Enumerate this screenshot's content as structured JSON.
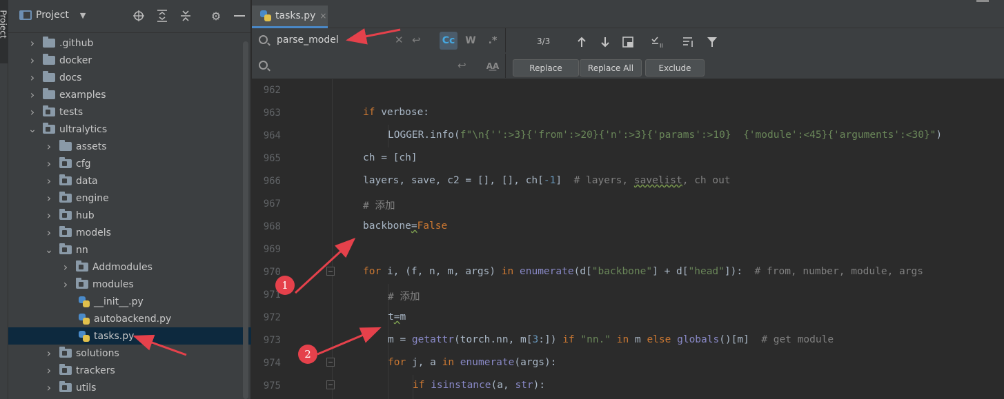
{
  "tool_stripe": {
    "project_label": "Project"
  },
  "project_panel": {
    "title": "Project",
    "tree": [
      {
        "label": ".github",
        "type": "folder",
        "depth": 1,
        "expanded": false
      },
      {
        "label": "docker",
        "type": "folder",
        "depth": 1,
        "expanded": false
      },
      {
        "label": "docs",
        "type": "folder",
        "depth": 1,
        "expanded": false
      },
      {
        "label": "examples",
        "type": "folder",
        "depth": 1,
        "expanded": false
      },
      {
        "label": "tests",
        "type": "package",
        "depth": 1,
        "expanded": false
      },
      {
        "label": "ultralytics",
        "type": "package",
        "depth": 1,
        "expanded": true
      },
      {
        "label": "assets",
        "type": "folder",
        "depth": 2,
        "expanded": false
      },
      {
        "label": "cfg",
        "type": "package",
        "depth": 2,
        "expanded": false
      },
      {
        "label": "data",
        "type": "package",
        "depth": 2,
        "expanded": false
      },
      {
        "label": "engine",
        "type": "package",
        "depth": 2,
        "expanded": false
      },
      {
        "label": "hub",
        "type": "package",
        "depth": 2,
        "expanded": false
      },
      {
        "label": "models",
        "type": "package",
        "depth": 2,
        "expanded": false
      },
      {
        "label": "nn",
        "type": "package",
        "depth": 2,
        "expanded": true
      },
      {
        "label": "Addmodules",
        "type": "package",
        "depth": 3,
        "expanded": false
      },
      {
        "label": "modules",
        "type": "package",
        "depth": 3,
        "expanded": false
      },
      {
        "label": "__init__.py",
        "type": "file",
        "depth": 3
      },
      {
        "label": "autobackend.py",
        "type": "file",
        "depth": 3
      },
      {
        "label": "tasks.py",
        "type": "file",
        "depth": 3,
        "selected": true
      },
      {
        "label": "solutions",
        "type": "package",
        "depth": 2,
        "expanded": false
      },
      {
        "label": "trackers",
        "type": "package",
        "depth": 2,
        "expanded": false
      },
      {
        "label": "utils",
        "type": "package",
        "depth": 2,
        "expanded": false
      }
    ]
  },
  "editor": {
    "tab": {
      "label": "tasks.py",
      "close": "×"
    },
    "find": {
      "search_value": "parse_model",
      "replace_value": "",
      "match_count": "3/3",
      "opt_case": "Cc",
      "opt_words": "W",
      "opt_regex": ".*",
      "opt_preserve": "A͟A",
      "btn_replace": "Replace",
      "btn_replace_all": "Replace All",
      "btn_exclude": "Exclude"
    },
    "lines": [
      {
        "num": "962"
      },
      {
        "num": "963"
      },
      {
        "num": "964"
      },
      {
        "num": "965"
      },
      {
        "num": "966"
      },
      {
        "num": "967"
      },
      {
        "num": "968"
      },
      {
        "num": "969"
      },
      {
        "num": "970"
      },
      {
        "num": "971"
      },
      {
        "num": "972"
      },
      {
        "num": "973"
      },
      {
        "num": "974"
      },
      {
        "num": "975"
      }
    ],
    "code": {
      "l963_kw": "if",
      "l963_rest": " verbose:",
      "l964_a": "LOGGER.info(",
      "l964_b": "f\"\\n{'':>3}{'from':>20}{'n':>3}{'params':>10}  {'module':<45}{'arguments':<30}\"",
      "l964_c": ")",
      "l965": "ch = [ch]",
      "l966_a": "layers, save, c2 = [], [], ch[",
      "l966_num": "-1",
      "l966_b": "]  ",
      "l966_cm_a": "# layers, ",
      "l966_cm_wav": "savelist",
      "l966_cm_b": ", ch out",
      "l967": "# 添加",
      "l968_a": "backbone",
      "l968_eq": "=",
      "l968_kw": "False",
      "l970_kw1": "for",
      "l970_a": " i, (f, n, m, args) ",
      "l970_kw2": "in",
      "l970_sp": " ",
      "l970_bi": "enumerate",
      "l970_b": "(d[",
      "l970_st1": "\"backbone\"",
      "l970_c": "] + d[",
      "l970_st2": "\"head\"",
      "l970_d": "]):  ",
      "l970_cm": "# from, number, module, args",
      "l971": "# 添加",
      "l972_a": "t",
      "l972_eq": "=",
      "l972_b": "m",
      "l973_a": "m = ",
      "l973_bi1": "getattr",
      "l973_b": "(torch.nn, m[",
      "l973_num": "3",
      "l973_c": ":]) ",
      "l973_kw1": "if",
      "l973_sp": " ",
      "l973_st": "\"nn.\"",
      "l973_sp2": " ",
      "l973_kw2": "in",
      "l973_d": " m ",
      "l973_kw3": "else",
      "l973_sp3": " ",
      "l973_bi2": "globals",
      "l973_e": "()[m]  ",
      "l973_cm": "# get module",
      "l974_kw1": "for",
      "l974_a": " j, a ",
      "l974_kw2": "in",
      "l974_sp": " ",
      "l974_bi": "enumerate",
      "l974_b": "(args):",
      "l975_kw": "if",
      "l975_sp": " ",
      "l975_bi": "isinstance",
      "l975_a": "(a, ",
      "l975_bi2": "str",
      "l975_b": "):"
    }
  },
  "annotations": {
    "badge1": "1",
    "badge2": "2",
    "arrow_color": "#e5414b"
  },
  "colors": {
    "keyword": "#cc7832",
    "string": "#6a8759",
    "comment": "#808080",
    "number": "#6897bb",
    "builtin": "#8888c6",
    "selection": "#0d293e",
    "accent": "#4a88c7"
  }
}
